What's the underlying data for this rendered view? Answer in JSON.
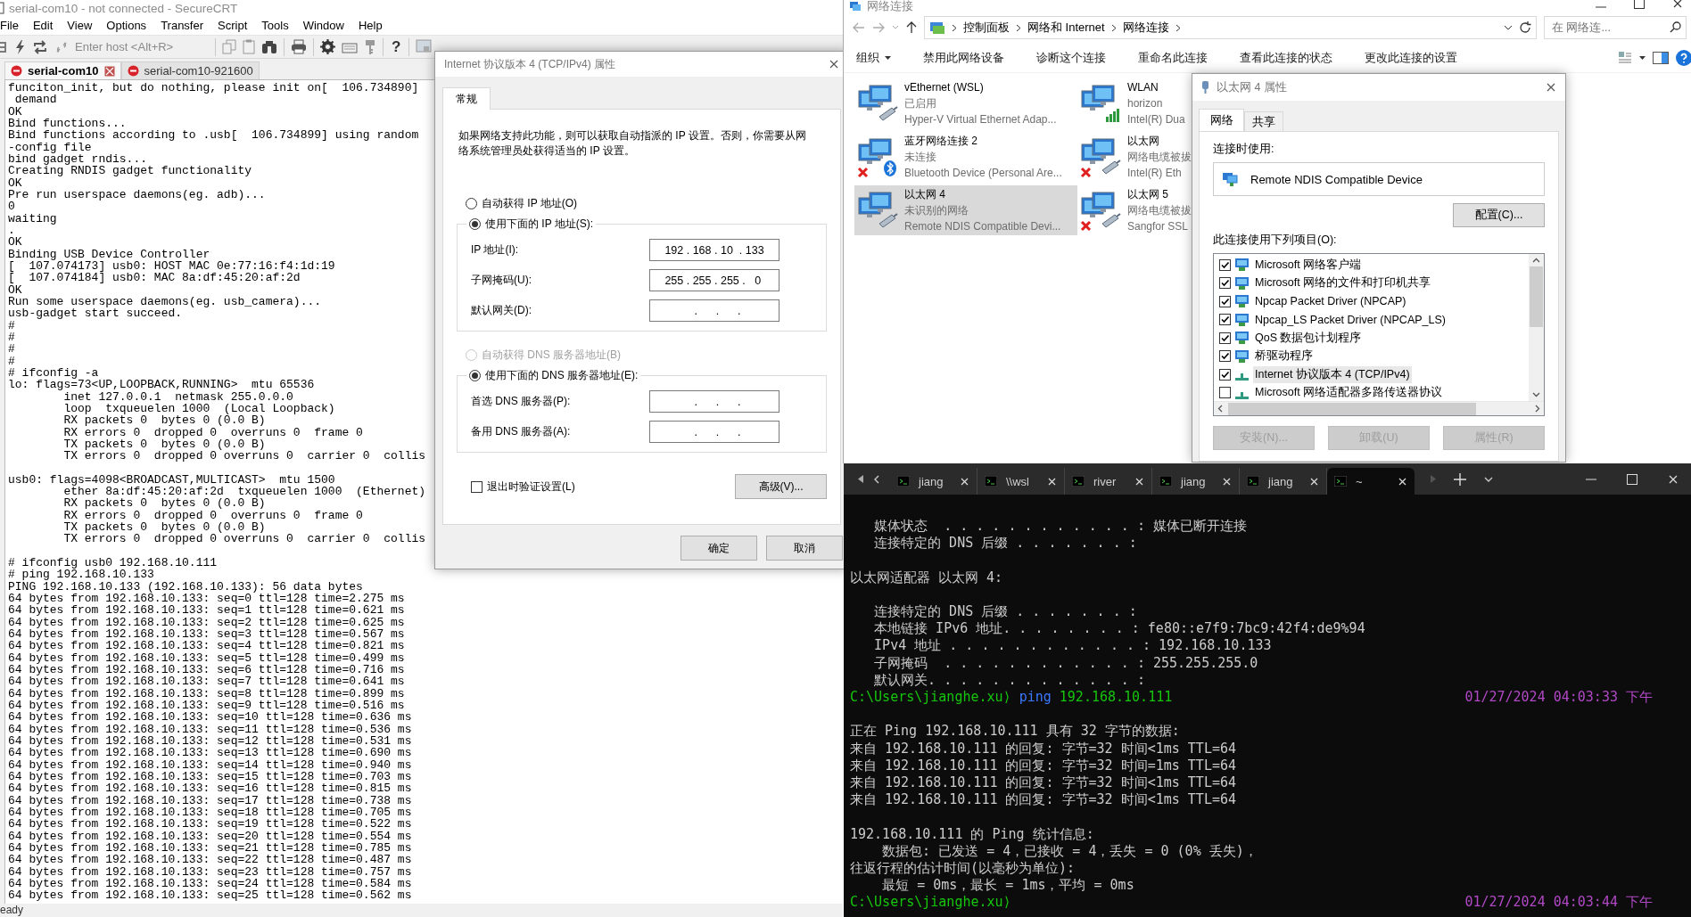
{
  "securecrt": {
    "title": "serial-com10 - not connected - SecureCRT",
    "menu": [
      "File",
      "Edit",
      "View",
      "Options",
      "Transfer",
      "Script",
      "Tools",
      "Window",
      "Help"
    ],
    "toolbar": {
      "host_placeholder": "Enter host <Alt+R>",
      "help": "?"
    },
    "tabs": [
      {
        "label": "serial-com10",
        "selected": true
      },
      {
        "label": "serial-com10-921600",
        "selected": false
      }
    ],
    "output": [
      [
        "funciton_init, but do nothing, please init on[  106.734890]",
        " demand",
        "OK",
        "Bind functions...",
        "Bind functions according to .usb[  106.734899] using random",
        "-config file",
        "bind gadget rndis...",
        "Creating RNDIS gadget functionality",
        "OK",
        "Pre run userspace daemons(eg. adb)...",
        "0",
        "waiting",
        ".",
        "OK",
        "Binding USB Device Controller",
        "[  107.074173] usb0: HOST MAC 0e:77:16:f4:1d:19",
        "[  107.074184] usb0: MAC 8a:df:45:20:af:2d",
        "OK",
        "Run some userspace daemons(eg. usb_camera)...",
        "usb-gadget start succeed.",
        "#",
        "#",
        "#",
        "#",
        "# ifconfig -a",
        "lo: flags=73<UP,LOOPBACK,RUNNING>  mtu 65536",
        "        inet 127.0.0.1  netmask 255.0.0.0",
        "        loop  txqueuelen 1000  (Local Loopback)",
        "        RX packets 0  bytes 0 (0.0 B)",
        "        RX errors 0  dropped 0  overruns 0  frame 0",
        "        TX packets 0  bytes 0 (0.0 B)",
        "        TX errors 0  dropped 0 overruns 0  carrier 0  collis"
      ],
      [
        "usb0: flags=4098<BROADCAST,MULTICAST>  mtu 1500",
        "        ether 8a:df:45:20:af:2d  txqueuelen 1000  (Ethernet)",
        "        RX packets 0  bytes 0 (0.0 B)",
        "        RX errors 0  dropped 0  overruns 0  frame 0",
        "        TX packets 0  bytes 0 (0.0 B)",
        "        TX errors 0  dropped 0 overruns 0  carrier 0  collis"
      ],
      [
        "# ifconfig usb0 192.168.10.111",
        "# ping 192.168.10.133",
        "PING 192.168.10.133 (192.168.10.133): 56 data bytes",
        "64 bytes from 192.168.10.133: seq=0 ttl=128 time=2.275 ms",
        "64 bytes from 192.168.10.133: seq=1 ttl=128 time=0.621 ms",
        "64 bytes from 192.168.10.133: seq=2 ttl=128 time=0.625 ms",
        "64 bytes from 192.168.10.133: seq=3 ttl=128 time=0.567 ms",
        "64 bytes from 192.168.10.133: seq=4 ttl=128 time=0.821 ms",
        "64 bytes from 192.168.10.133: seq=5 ttl=128 time=0.499 ms",
        "64 bytes from 192.168.10.133: seq=6 ttl=128 time=0.716 ms",
        "64 bytes from 192.168.10.133: seq=7 ttl=128 time=0.641 ms",
        "64 bytes from 192.168.10.133: seq=8 ttl=128 time=0.899 ms",
        "64 bytes from 192.168.10.133: seq=9 ttl=128 time=0.516 ms",
        "64 bytes from 192.168.10.133: seq=10 ttl=128 time=0.636 ms",
        "64 bytes from 192.168.10.133: seq=11 ttl=128 time=0.536 ms",
        "64 bytes from 192.168.10.133: seq=12 ttl=128 time=0.531 ms",
        "64 bytes from 192.168.10.133: seq=13 ttl=128 time=0.690 ms",
        "64 bytes from 192.168.10.133: seq=14 ttl=128 time=0.940 ms",
        "64 bytes from 192.168.10.133: seq=15 ttl=128 time=0.703 ms",
        "64 bytes from 192.168.10.133: seq=16 ttl=128 time=0.815 ms",
        "64 bytes from 192.168.10.133: seq=17 ttl=128 time=0.738 ms",
        "64 bytes from 192.168.10.133: seq=18 ttl=128 time=0.705 ms",
        "64 bytes from 192.168.10.133: seq=19 ttl=128 time=0.522 ms",
        "64 bytes from 192.168.10.133: seq=20 ttl=128 time=0.554 ms",
        "64 bytes from 192.168.10.133: seq=21 ttl=128 time=0.785 ms",
        "64 bytes from 192.168.10.133: seq=22 ttl=128 time=0.487 ms",
        "64 bytes from 192.168.10.133: seq=23 ttl=128 time=0.757 ms",
        "64 bytes from 192.168.10.133: seq=24 ttl=128 time=0.584 ms",
        "64 bytes from 192.168.10.133: seq=25 ttl=128 time=0.562 ms"
      ]
    ],
    "status": "eady"
  },
  "ipv4_dialog": {
    "title": "Internet 协议版本 4 (TCP/IPv4) 属性",
    "tabs": [
      {
        "label": "常规",
        "selected": true
      }
    ],
    "description": "如果网络支持此功能，则可以获取自动指派的 IP 设置。否则，你需要从网络系统管理员处获得适当的 IP 设置。",
    "ip_mode": [
      {
        "label": "自动获得 IP 地址(O)",
        "selected": false,
        "disabled": false
      },
      {
        "label": "使用下面的 IP 地址(S):",
        "selected": true,
        "disabled": false
      }
    ],
    "ip_fields": [
      {
        "label": "IP 地址(I):",
        "value": "192 . 168 . 10  . 133"
      },
      {
        "label": "子网掩码(U):",
        "value": "255 . 255 . 255 .   0 "
      },
      {
        "label": "默认网关(D):",
        "value": "     .      .      .   "
      }
    ],
    "dns_mode": [
      {
        "label": "自动获得 DNS 服务器地址(B)",
        "selected": false,
        "disabled": true
      },
      {
        "label": "使用下面的 DNS 服务器地址(E):",
        "selected": true,
        "disabled": false
      }
    ],
    "dns_fields": [
      {
        "label": "首选 DNS 服务器(P):",
        "value": "     .      .      .   "
      },
      {
        "label": "备用 DNS 服务器(A):",
        "value": "     .      .      .   "
      }
    ],
    "validate_on_exit": {
      "label": "退出时验证设置(L)",
      "checked": false
    },
    "advanced_button": "高级(V)...",
    "buttons": [
      "确定",
      "取消"
    ]
  },
  "network_connections": {
    "title": "网络连接",
    "breadcrumb": [
      "控制面板",
      "网络和 Internet",
      "网络连接"
    ],
    "search_placeholder": "在 网络连...",
    "commands": [
      {
        "label": "组织",
        "dropdown": true
      },
      {
        "label": "禁用此网络设备",
        "dropdown": false
      },
      {
        "label": "诊断这个连接",
        "dropdown": false
      },
      {
        "label": "重命名此连接",
        "dropdown": false
      },
      {
        "label": "查看此连接的状态",
        "dropdown": false
      },
      {
        "label": "更改此连接的设置",
        "dropdown": false
      }
    ],
    "adapters": [
      {
        "name": "vEthernet (WSL)",
        "status": "已启用",
        "device": "Hyper-V Virtual Ethernet Adap...",
        "kind": "ethernet",
        "disconnected": false,
        "selected": false
      },
      {
        "name": "WLAN",
        "status": "horizon",
        "device": "Intel(R) Dua",
        "kind": "wifi",
        "disconnected": false,
        "selected": false
      },
      {
        "name": "蓝牙网络连接 2",
        "status": "未连接",
        "device": "Bluetooth Device (Personal Are...",
        "kind": "bluetooth",
        "disconnected": true,
        "selected": false
      },
      {
        "name": "以太网",
        "status": "网络电缆被拔",
        "device": "Intel(R) Eth",
        "kind": "ethernet",
        "disconnected": true,
        "selected": false
      },
      {
        "name": "以太网 4",
        "status": "未识别的网络",
        "device": "Remote NDIS Compatible Devi...",
        "kind": "ethernet",
        "disconnected": false,
        "selected": true
      },
      {
        "name": "以太网 5",
        "status": "网络电缆被拔",
        "device": "Sangfor SSL",
        "kind": "ethernet",
        "disconnected": true,
        "selected": false
      }
    ]
  },
  "adapter_properties": {
    "title": "以太网 4 属性",
    "tabs": [
      {
        "label": "网络",
        "selected": true
      },
      {
        "label": "共享",
        "selected": false
      }
    ],
    "connect_using_label": "连接时使用:",
    "device": "Remote NDIS Compatible Device",
    "configure_button": "配置(C)...",
    "items_label": "此连接使用下列项目(O):",
    "items": [
      {
        "label": "Microsoft 网络客户端",
        "checked": true,
        "selected": false,
        "kind": "client"
      },
      {
        "label": "Microsoft 网络的文件和打印机共享",
        "checked": true,
        "selected": false,
        "kind": "client"
      },
      {
        "label": "Npcap Packet Driver (NPCAP)",
        "checked": true,
        "selected": false,
        "kind": "client"
      },
      {
        "label": "Npcap_LS Packet Driver (NPCAP_LS)",
        "checked": true,
        "selected": false,
        "kind": "client"
      },
      {
        "label": "QoS 数据包计划程序",
        "checked": true,
        "selected": false,
        "kind": "client"
      },
      {
        "label": "桥驱动程序",
        "checked": true,
        "selected": false,
        "kind": "client"
      },
      {
        "label": "Internet 协议版本 4 (TCP/IPv4)",
        "checked": true,
        "selected": true,
        "kind": "protocol"
      },
      {
        "label": "Microsoft 网络适配器多路传送器协议",
        "checked": false,
        "selected": false,
        "kind": "protocol"
      }
    ],
    "buttons": [
      {
        "label": "安装(N)...",
        "disabled": true
      },
      {
        "label": "卸载(U)",
        "disabled": true
      },
      {
        "label": "属性(R)",
        "disabled": true
      }
    ]
  },
  "terminal": {
    "tabs": [
      {
        "label": "jiang",
        "selected": false
      },
      {
        "label": "\\\\wsl",
        "selected": false
      },
      {
        "label": "river",
        "selected": false
      },
      {
        "label": "jiang",
        "selected": false
      },
      {
        "label": "jiang",
        "selected": false
      },
      {
        "label": "~",
        "selected": true
      }
    ],
    "output": [
      [
        {
          "kind": "text",
          "text": "   媒体状态  . . . . . . . . . . . . : 媒体已断开连接"
        },
        {
          "kind": "text",
          "text": "   连接特定的 DNS 后缀 . . . . . . . :"
        }
      ],
      [
        {
          "kind": "text",
          "text": "以太网适配器 以太网 4:"
        }
      ],
      [
        {
          "kind": "text",
          "text": "   连接特定的 DNS 后缀 . . . . . . . :"
        },
        {
          "kind": "text",
          "text": "   本地链接 IPv6 地址. . . . . . . . : fe80::e7f9:7bc9:42f4:de9%94"
        },
        {
          "kind": "text",
          "text": "   IPv4 地址 . . . . . . . . . . . . : 192.168.10.133"
        },
        {
          "kind": "text",
          "text": "   子网掩码  . . . . . . . . . . . . : 255.255.255.0"
        },
        {
          "kind": "text",
          "text": "   默认网关. . . . . . . . . . . . . :"
        },
        {
          "kind": "prompt",
          "path": "C:\\Users\\jianghe.xu⟩",
          "command": "ping",
          "argument": "192.168.10.111",
          "time": "01/27/2024 04:03:33 下午"
        }
      ],
      [
        {
          "kind": "text",
          "text": "正在 Ping 192.168.10.111 具有 32 字节的数据:"
        },
        {
          "kind": "text",
          "text": "来自 192.168.10.111 的回复: 字节=32 时间<1ms TTL=64"
        },
        {
          "kind": "text",
          "text": "来自 192.168.10.111 的回复: 字节=32 时间=1ms TTL=64"
        },
        {
          "kind": "text",
          "text": "来自 192.168.10.111 的回复: 字节=32 时间<1ms TTL=64"
        },
        {
          "kind": "text",
          "text": "来自 192.168.10.111 的回复: 字节=32 时间<1ms TTL=64"
        }
      ],
      [
        {
          "kind": "text",
          "text": "192.168.10.111 的 Ping 统计信息:"
        },
        {
          "kind": "text",
          "text": "    数据包: 已发送 = 4，已接收 = 4，丢失 = 0 (0% 丢失)，"
        },
        {
          "kind": "text",
          "text": "往返行程的估计时间(以毫秒为单位):"
        },
        {
          "kind": "text",
          "text": "    最短 = 0ms，最长 = 1ms，平均 = 0ms"
        },
        {
          "kind": "prompt",
          "path": "C:\\Users\\jianghe.xu⟩",
          "time": "01/27/2024 04:03:44 下午"
        }
      ]
    ]
  }
}
